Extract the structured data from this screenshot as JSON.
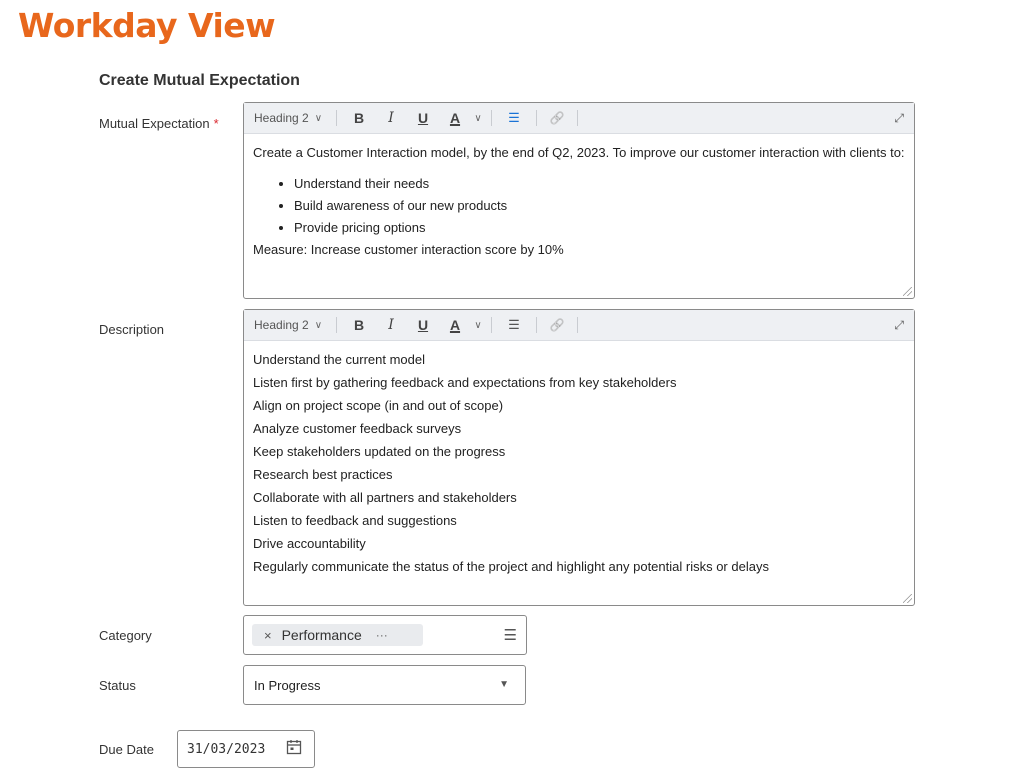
{
  "header": {
    "title": "Workday View"
  },
  "form": {
    "title": "Create Mutual Expectation",
    "required_mark": "*",
    "toolbar": {
      "heading_label": "Heading 2",
      "bold": "B",
      "italic": "I",
      "underline": "U",
      "color": "A",
      "list": "☰",
      "link": "🔗",
      "expand": "⤢"
    },
    "mutual_expectation": {
      "label": "Mutual Expectation",
      "intro": "Create a Customer Interaction model,  by the end of Q2, 2023. To improve our customer interaction with clients to:",
      "bullets": [
        "Understand their needs",
        "Build awareness of our new products",
        "Provide pricing options"
      ],
      "measure": "Measure: Increase customer interaction score by 10%"
    },
    "description": {
      "label": "Description",
      "lines": [
        "Understand the current model",
        "Listen first by gathering feedback and expectations from key stakeholders",
        "Align on project scope (in and out of scope)",
        "Analyze customer feedback surveys",
        "Keep stakeholders updated on the progress",
        "Research best practices",
        "Collaborate with all partners and stakeholders",
        "Listen to feedback and suggestions",
        "Drive accountability",
        "Regularly communicate the status of the project and highlight any potential risks or delays"
      ]
    },
    "category": {
      "label": "Category",
      "selected": "Performance",
      "remove": "×",
      "more": "···"
    },
    "status": {
      "label": "Status",
      "value": "In Progress"
    },
    "due_date": {
      "label": "Due Date",
      "value": "31/03/2023"
    }
  },
  "colors": {
    "brand_orange": "#e8671c",
    "required_red": "#d9262d",
    "link_blue": "#1a73d6"
  },
  "icons": [
    "chevron-down-icon",
    "bold-icon",
    "italic-icon",
    "underline-icon",
    "text-color-icon",
    "bullet-list-icon",
    "link-icon",
    "expand-icon",
    "resize-handle-icon",
    "remove-icon",
    "more-icon",
    "prompt-list-icon",
    "caret-down-icon",
    "calendar-icon"
  ]
}
